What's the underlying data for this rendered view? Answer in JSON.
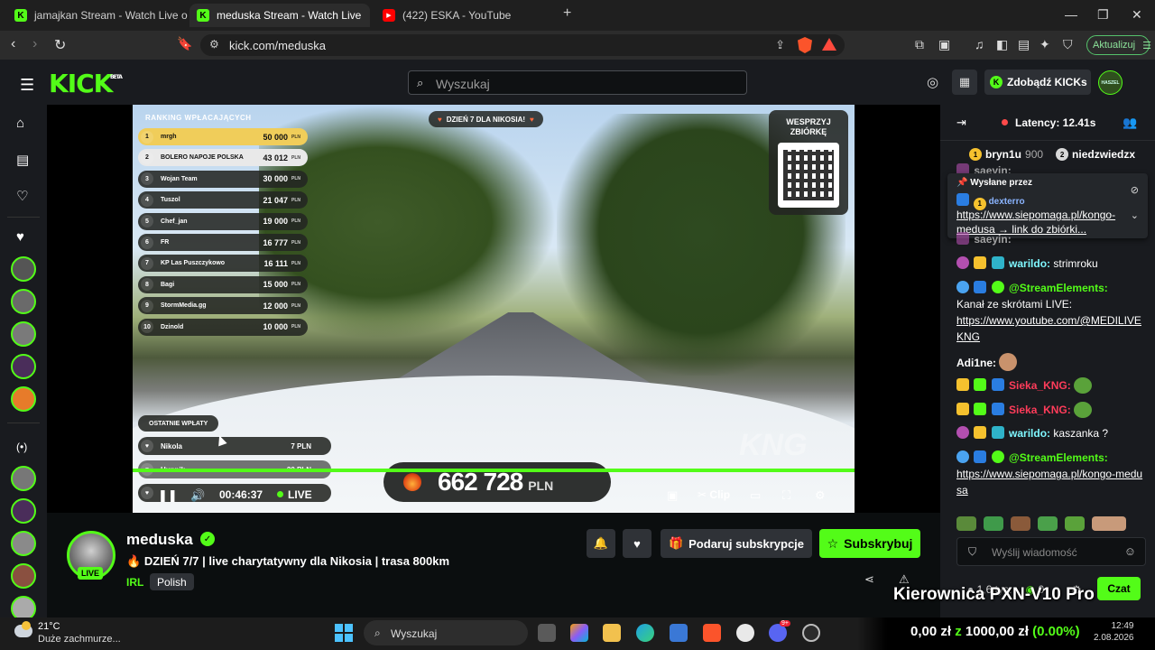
{
  "browser": {
    "tabs": [
      {
        "title": "jamajkan Stream - Watch Live on",
        "icon": "kick-icon",
        "active": false
      },
      {
        "title": "meduska Stream - Watch Live",
        "icon": "kick-icon",
        "active": true
      },
      {
        "title": "(422) ESKA - YouTube",
        "icon": "youtube-icon",
        "active": false
      }
    ],
    "url": "kick.com/meduska",
    "update_label": "Aktualizuj",
    "brave_shield_count": "10"
  },
  "kick_header": {
    "logo": "KICK",
    "logo_badge": "BETA",
    "search_placeholder": "Wyszukaj",
    "kicks_button": "Zdobądź KICKs",
    "user_avatar_text": "HASZEL"
  },
  "video": {
    "ranking_title": "RANKING WPŁACAJĄCYCH",
    "ranking": [
      {
        "rank": "1",
        "name": "mrgh",
        "amount": "50 000"
      },
      {
        "rank": "2",
        "name": "BOLERO NAPOJE POLSKA",
        "amount": "43 012"
      },
      {
        "rank": "3",
        "name": "Wojan Team",
        "amount": "30 000"
      },
      {
        "rank": "4",
        "name": "Tuszol",
        "amount": "21 047"
      },
      {
        "rank": "5",
        "name": "Chef_jan",
        "amount": "19 000"
      },
      {
        "rank": "6",
        "name": "FR",
        "amount": "16 777"
      },
      {
        "rank": "7",
        "name": "KP Las Puszczykowo",
        "amount": "16 111"
      },
      {
        "rank": "8",
        "name": "Bagi",
        "amount": "15 000"
      },
      {
        "rank": "9",
        "name": "StormMedia.gg",
        "amount": "12 000"
      },
      {
        "rank": "10",
        "name": "Dzinold",
        "amount": "10 000"
      }
    ],
    "currency_small": "PLN",
    "day_badge": "DZIEŃ 7 DLA NIKOSIA!",
    "zbiorka_title": "WESPRZYJ ZBIÓRKĘ",
    "recent_title": "OSTATNIE WPŁATY",
    "recent": [
      {
        "name": "Nikola",
        "amount": "7 PLN"
      },
      {
        "name": "Hunnik",
        "amount": "20 PLN"
      },
      {
        "name": "",
        "amount": ""
      }
    ],
    "total": "662 728",
    "total_currency": "PLN",
    "watermark": "KNG",
    "player": {
      "time": "00:46:37",
      "live_label": "LIVE",
      "clip_label": "Clip"
    }
  },
  "stream": {
    "channel": "meduska",
    "live_badge": "LIVE",
    "title": "DZIEŃ 7/7 | live charytatywny dla Nikosia | trasa 800km",
    "category": "IRL",
    "language": "Polish",
    "gift_sub_label": "Podaruj subskrypcje",
    "subscribe_label": "Subskrybuj"
  },
  "chat": {
    "latency": "Latency: 12.41s",
    "leaderboard": [
      {
        "place": "1",
        "name": "bryn1u",
        "value": "900"
      },
      {
        "place": "2",
        "name": "niedzwiedzx",
        "value": ""
      }
    ],
    "pinned_label": "Wysłane przez",
    "pinned_user": "dexterro",
    "pinned_badge": "1",
    "pinned_message": "https://www.siepomaga.pl/kongo-medusa → link do zbiórki...",
    "messages": [
      {
        "user": "saeyin:",
        "text": "",
        "color": "#ffffff"
      },
      {
        "user": "warildo:",
        "text": "strimroku",
        "color": "#7ff7ff"
      },
      {
        "user": "@StreamElements:",
        "text": "Kanał ze skrótami LIVE: ",
        "link": "https://www.youtube.com/@MEDILIVEKNG",
        "color": "#53fc18"
      },
      {
        "user": "Adi1ne:",
        "text": "",
        "color": "#ffffff"
      },
      {
        "user": "Sieka_KNG:",
        "text": "",
        "color": "#ff3c5a"
      },
      {
        "user": "Sieka_KNG:",
        "text": "",
        "color": "#ff3c5a"
      },
      {
        "user": "warildo:",
        "text": "kaszanka ?",
        "color": "#7ff7ff"
      },
      {
        "user": "@StreamElements:",
        "text": "",
        "link": "https://www.siepomaga.pl/kongo-medusa",
        "color": "#53fc18"
      }
    ],
    "input_placeholder": "Wyślij wiadomość",
    "viewers": "1,6 tys.",
    "zero_count": "0",
    "send_label": "Czat"
  },
  "overlay": {
    "product_text": "Kierownica PXN-V10 Pro",
    "money_left": "0,00 zł",
    "money_mid": "z",
    "money_goal": "1000,00 zł",
    "money_pct": "(0.00%)"
  },
  "taskbar": {
    "temperature": "21°C",
    "weather": "Duże zachmurze...",
    "search_label": "Wyszukaj",
    "time": "12:49",
    "date": "2.08.2026",
    "discord_badge": "9+"
  }
}
